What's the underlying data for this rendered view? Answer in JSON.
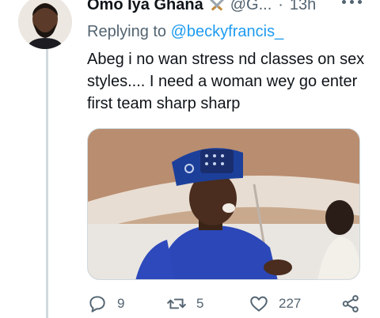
{
  "tweet": {
    "author_name": "Omo Iya Ghana",
    "author_emoji": "crossed-swords-emoji",
    "handle": "@G...",
    "separator": "·",
    "time": "13h",
    "replying_prefix": "Replying to",
    "replying_to": "@beckyfrancis_",
    "text": "Abeg i no wan stress nd classes on sex styles.... I need a woman wey go enter first team sharp sharp"
  },
  "media": {
    "description_icon": "photo-of-man-in-blue-cap"
  },
  "actions": {
    "reply_count": "9",
    "retweet_count": "5",
    "like_count": "227"
  },
  "colors": {
    "text": "#0f1419",
    "muted": "#536471",
    "link": "#1d9bf0",
    "thread_line": "#cfd9de"
  }
}
